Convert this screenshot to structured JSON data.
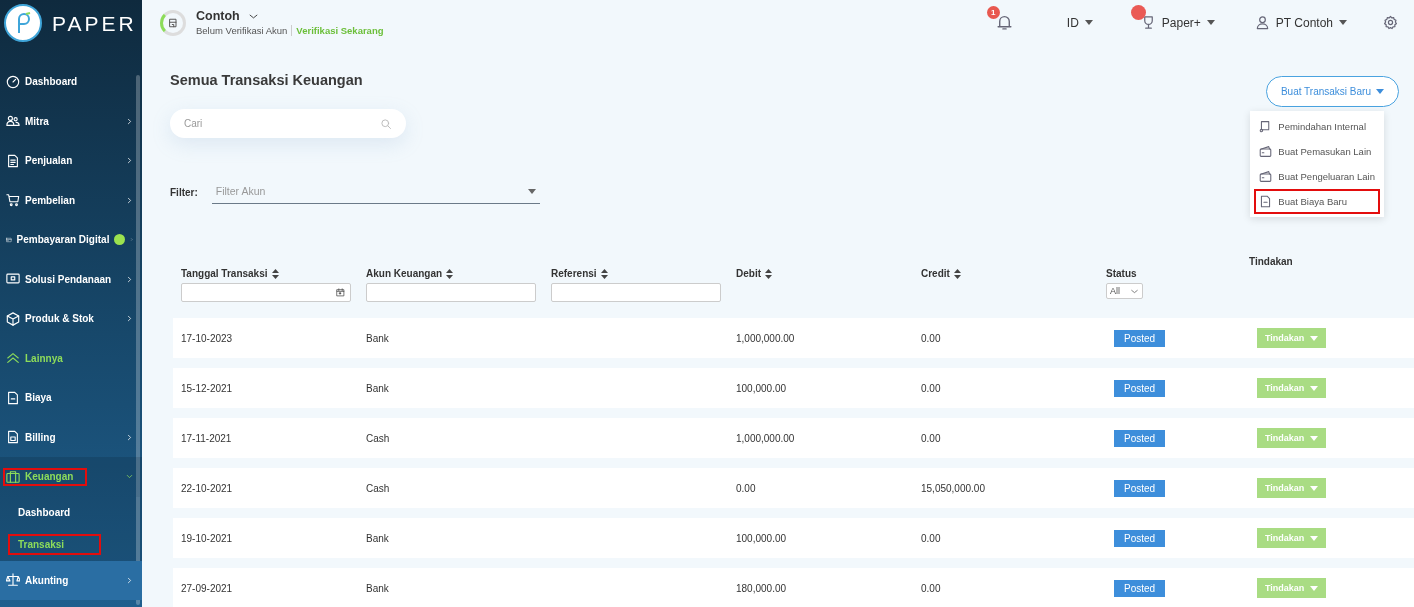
{
  "sidebar": {
    "logo": "PAPER",
    "items": [
      {
        "label": "Dashboard",
        "submenu": false,
        "expanded": false,
        "accent": false,
        "highlighted": false,
        "new_dot": false
      },
      {
        "label": "Mitra",
        "submenu": true,
        "expanded": false,
        "accent": false,
        "highlighted": false,
        "new_dot": false
      },
      {
        "label": "Penjualan",
        "submenu": true,
        "expanded": false,
        "accent": false,
        "highlighted": false,
        "new_dot": false
      },
      {
        "label": "Pembelian",
        "submenu": true,
        "expanded": false,
        "accent": false,
        "highlighted": false,
        "new_dot": false
      },
      {
        "label": "Pembayaran Digital",
        "submenu": true,
        "expanded": false,
        "accent": false,
        "highlighted": false,
        "new_dot": true
      },
      {
        "label": "Solusi Pendanaan",
        "submenu": true,
        "expanded": false,
        "accent": false,
        "highlighted": false,
        "new_dot": false
      },
      {
        "label": "Produk & Stok",
        "submenu": true,
        "expanded": false,
        "accent": false,
        "highlighted": false,
        "new_dot": false
      },
      {
        "label": "Lainnya",
        "submenu": false,
        "expanded": false,
        "accent": true,
        "highlighted": false,
        "new_dot": false
      },
      {
        "label": "Biaya",
        "submenu": false,
        "expanded": false,
        "accent": false,
        "highlighted": false,
        "new_dot": false
      },
      {
        "label": "Billing",
        "submenu": true,
        "expanded": false,
        "accent": false,
        "highlighted": false,
        "new_dot": false
      },
      {
        "label": "Keuangan",
        "submenu": true,
        "expanded": true,
        "accent": true,
        "highlighted": true,
        "new_dot": false,
        "children": [
          {
            "label": "Dashboard",
            "selected": false,
            "highlighted": false
          },
          {
            "label": "Transaksi",
            "selected": true,
            "highlighted": true
          }
        ]
      },
      {
        "label": "Akunting",
        "submenu": true,
        "expanded": false,
        "accent": false,
        "highlighted": false,
        "new_dot": false
      }
    ]
  },
  "header": {
    "company": "Contoh",
    "verification_status": "Belum Verifikasi Akun",
    "verify_link": "Verifikasi Sekarang",
    "notification_count": "1",
    "language": "ID",
    "plan": "Paper+",
    "user": "PT Contoh"
  },
  "page": {
    "title": "Semua Transaksi Keuangan",
    "search": {
      "placeholder": "Cari"
    },
    "filter_label": "Filter:",
    "filter": {
      "placeholder": "Filter Akun"
    },
    "new_button": "Buat Transaksi Baru",
    "new_menu": [
      {
        "label": "Pemindahan Internal",
        "highlighted": false
      },
      {
        "label": "Buat Pemasukan Lain",
        "highlighted": false
      },
      {
        "label": "Buat Pengeluaran Lain",
        "highlighted": false
      },
      {
        "label": "Buat Biaya Baru",
        "highlighted": true
      }
    ],
    "table": {
      "columns": [
        {
          "label": "Tanggal Transaksi",
          "sortable": true,
          "kind": "date"
        },
        {
          "label": "Akun Keuangan",
          "sortable": true,
          "kind": "text"
        },
        {
          "label": "Referensi",
          "sortable": true,
          "kind": "text"
        },
        {
          "label": "Debit",
          "sortable": true,
          "kind": "plain"
        },
        {
          "label": "Credit",
          "sortable": true,
          "kind": "plain"
        },
        {
          "label": "Status",
          "sortable": false,
          "kind": "select",
          "filter_value": "All"
        },
        {
          "label": "Tindakan",
          "sortable": false,
          "kind": "plain"
        }
      ],
      "rows": [
        {
          "date": "17-10-2023",
          "account": "Bank",
          "debit": "1,000,000.00",
          "credit": "0.00",
          "status": "Posted",
          "action": "Tindakan"
        },
        {
          "date": "15-12-2021",
          "account": "Bank",
          "debit": "100,000.00",
          "credit": "0.00",
          "status": "Posted",
          "action": "Tindakan"
        },
        {
          "date": "17-11-2021",
          "account": "Cash",
          "debit": "1,000,000.00",
          "credit": "0.00",
          "status": "Posted",
          "action": "Tindakan"
        },
        {
          "date": "22-10-2021",
          "account": "Cash",
          "debit": "0.00",
          "credit": "15,050,000.00",
          "status": "Posted",
          "action": "Tindakan"
        },
        {
          "date": "19-10-2021",
          "account": "Bank",
          "debit": "100,000.00",
          "credit": "0.00",
          "status": "Posted",
          "action": "Tindakan"
        },
        {
          "date": "27-09-2021",
          "account": "Bank",
          "debit": "180,000.00",
          "credit": "0.00",
          "status": "Posted",
          "action": "Tindakan"
        }
      ]
    }
  }
}
